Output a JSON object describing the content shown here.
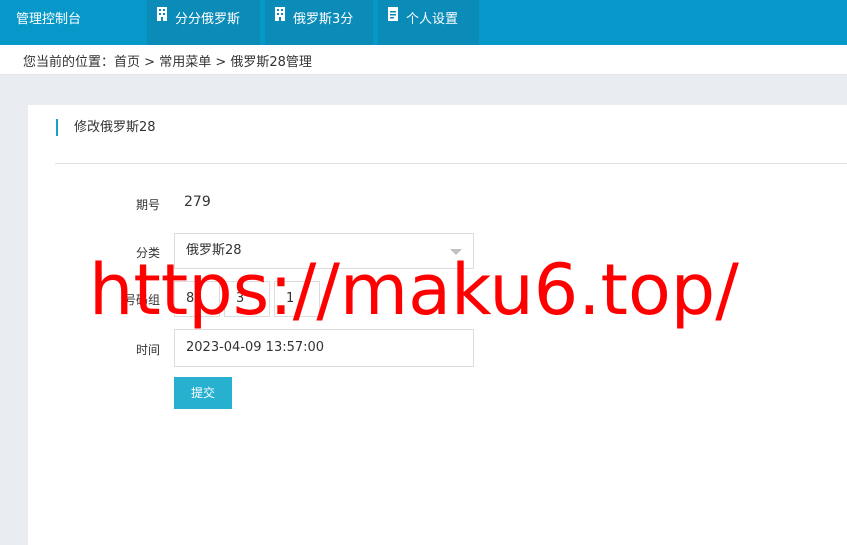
{
  "app": {
    "title": "管理控制台"
  },
  "nav": {
    "tabs": [
      {
        "label": "分分俄罗斯",
        "icon": "building-icon"
      },
      {
        "label": "俄罗斯3分",
        "icon": "building-icon"
      },
      {
        "label": "个人设置",
        "icon": "document-icon"
      }
    ]
  },
  "breadcrumb": {
    "prefix": "您当前的位置：",
    "items": [
      "首页",
      "常用菜单",
      "俄罗斯28管理"
    ],
    "separator": " > "
  },
  "panel": {
    "title": "修改俄罗斯28"
  },
  "form": {
    "period_label": "期号",
    "period_value": "279",
    "category_label": "分类",
    "category_value": "俄罗斯28",
    "numbers_label": "号码组",
    "numbers": [
      "8",
      "3",
      "1"
    ],
    "time_label": "时间",
    "time_value": "2023-04-09 13:57:00",
    "submit_label": "提交"
  },
  "watermark": {
    "text": "https://maku6.top/"
  },
  "colors": {
    "topbar": "#0598c9",
    "tab_active": "#0a8bb8",
    "accent": "#1aa0d0",
    "submit": "#28b0d1",
    "watermark": "#ff0000",
    "background": "#e9edf2"
  }
}
